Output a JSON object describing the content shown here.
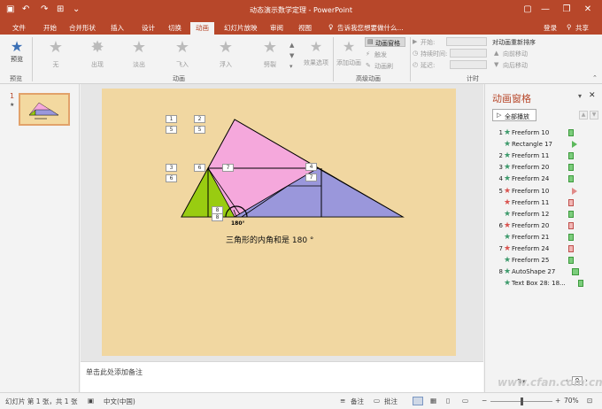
{
  "window": {
    "title": "动态演示数学定理 - PowerPoint",
    "help_label": "?",
    "minimize_label": "—",
    "restore_label": "❐",
    "close_label": "✕"
  },
  "tabs": [
    "文件",
    "开始",
    "合并形状",
    "插入",
    "设计",
    "切换",
    "动画",
    "幻灯片放映",
    "审阅",
    "视图"
  ],
  "active_tab": "动画",
  "tell_me": "告诉我您想要做什么...",
  "account": {
    "login": "登录",
    "share": "共享"
  },
  "ribbon": {
    "preview_label": "预览",
    "preview_group": "预览",
    "effects": [
      "无",
      "出现",
      "淡出",
      "飞入",
      "浮入",
      "劈裂"
    ],
    "effect_options": "效果选项",
    "animation_group": "动画",
    "add_animation": "添加动画",
    "animation_pane": "动画窗格",
    "trigger": "触发",
    "painter": "动画刷",
    "advanced_group": "高级动画",
    "start_label": "开始:",
    "duration_label": "持续时间:",
    "delay_label": "延迟:",
    "timing_group": "计时",
    "reorder_title": "对动画重新排序",
    "move_earlier": "向前移动",
    "move_later": "向后移动"
  },
  "thumbnails": {
    "slide_number": "1",
    "star": "★"
  },
  "slide": {
    "caption": "三角形的内角和是 180 °",
    "angle_label": "180°",
    "labels": [
      "1",
      "2",
      "5",
      "5",
      "3",
      "6",
      "6",
      "7",
      "4",
      "7",
      "8",
      "8"
    ]
  },
  "notes_placeholder": "单击此处添加备注",
  "anim_pane": {
    "title": "动画窗格",
    "play_all": "全部播放",
    "items": [
      {
        "num": "1",
        "star": "★",
        "star_color": "#3d9a6b",
        "name": "Freeform 10",
        "bar": "green"
      },
      {
        "num": "",
        "star": "★",
        "star_color": "#3d9a6b",
        "name": "Rectangle 17",
        "bar": "triangle-green"
      },
      {
        "num": "2",
        "star": "★",
        "star_color": "#3d9a6b",
        "name": "Freeform 11",
        "bar": "green"
      },
      {
        "num": "3",
        "star": "★",
        "star_color": "#3d9a6b",
        "name": "Freeform 20",
        "bar": "green"
      },
      {
        "num": "4",
        "star": "★",
        "star_color": "#3d9a6b",
        "name": "Freeform 24",
        "bar": "green"
      },
      {
        "num": "5",
        "star": "★",
        "star_color": "#d9534f",
        "name": "Freeform 10",
        "bar": "triangle-red"
      },
      {
        "num": "",
        "star": "★",
        "star_color": "#d9534f",
        "name": "Freeform 11",
        "bar": "red"
      },
      {
        "num": "",
        "star": "★",
        "star_color": "#3d9a6b",
        "name": "Freeform 12",
        "bar": "green"
      },
      {
        "num": "6",
        "star": "★",
        "star_color": "#d9534f",
        "name": "Freeform 20",
        "bar": "red"
      },
      {
        "num": "",
        "star": "★",
        "star_color": "#3d9a6b",
        "name": "Freeform 21",
        "bar": "green"
      },
      {
        "num": "7",
        "star": "★",
        "star_color": "#d9534f",
        "name": "Freeform 24",
        "bar": "red"
      },
      {
        "num": "",
        "star": "★",
        "star_color": "#3d9a6b",
        "name": "Freeform 25",
        "bar": "green"
      },
      {
        "num": "8",
        "star": "★",
        "star_color": "#3d9a6b",
        "name": "AutoShape 27",
        "bar": "green-wide"
      },
      {
        "num": "",
        "star": "★",
        "star_color": "#3d9a6b",
        "name": "Text Box 28: 18...",
        "bar": "green"
      }
    ],
    "reorder_label": "重新排序",
    "page_value": "0"
  },
  "status": {
    "slide_info": "幻灯片 第 1 张，共 1 张",
    "language": "中文(中国)",
    "notes_btn": "备注",
    "comments_btn": "批注",
    "zoom": "70%"
  },
  "watermark": "www.cfan.com.cn",
  "colors": {
    "accent": "#b7472a",
    "pink": "#f5a8dc",
    "purple": "#9a97db",
    "green": "#99cc11",
    "slide_bg": "#f1d7a1"
  }
}
